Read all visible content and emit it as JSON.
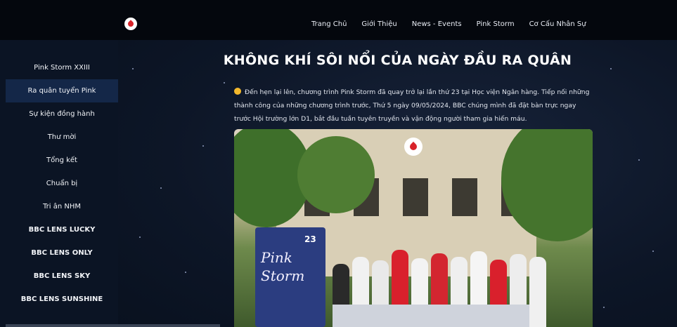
{
  "nav": {
    "items": [
      "Trang Chủ",
      "Giới Thiệu",
      "News - Events",
      "Pink Storm",
      "Cơ Cấu Nhân Sự"
    ]
  },
  "sidebar": {
    "items": [
      {
        "label": "Pink Storm XXIII"
      },
      {
        "label": "Ra quân tuyển Pink"
      },
      {
        "label": "Sự kiện đồng hành"
      },
      {
        "label": "Thư mời"
      },
      {
        "label": "Tổng kết"
      },
      {
        "label": "Chuẩn bị"
      },
      {
        "label": "Tri ân NHM"
      },
      {
        "label": "BBC LENS LUCKY"
      },
      {
        "label": "BBC LENS ONLY"
      },
      {
        "label": "BBC LENS SKY"
      },
      {
        "label": "BBC LENS SUNSHINE"
      }
    ],
    "active_index": 1
  },
  "article": {
    "title": "KHÔNG KHÍ SÔI NỔI CỦA NGÀY ĐẦU RA QUÂN",
    "body": "Đến hẹn lại lên, chương trình Pink Storm đã quay trở lại lần thứ 23 tại Học viện Ngân hàng. Tiếp nối những thành công của những chương trình trước, Thứ 5 ngày 09/05/2024, BBC chúng mình đã đặt bàn trực ngay trước Hội trường lớn D1, bắt đầu tuần tuyên truyền và vận động người tham gia hiến máu.",
    "emoji_icon": "smiling-face-icon"
  },
  "photo": {
    "banner_line1": "Pink",
    "banner_line2": "Storm",
    "banner_number": "23"
  },
  "colors": {
    "topbar": "#04070d",
    "background": "#0b1424",
    "active_sidebar": "#142748",
    "logo_red": "#d8232a"
  }
}
